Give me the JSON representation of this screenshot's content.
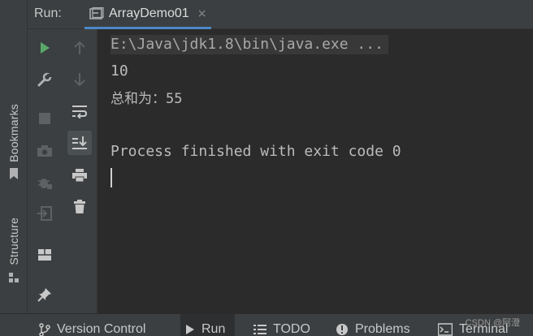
{
  "header": {
    "run_label": "Run:",
    "tab_label": "ArrayDemo01",
    "tab_close": "×"
  },
  "left_strip": {
    "bookmarks_label": "Bookmarks",
    "structure_label": "Structure"
  },
  "console": {
    "command": "E:\\Java\\jdk1.8\\bin\\java.exe ...",
    "lines": [
      "10",
      "总和为：55",
      "Process finished with exit code 0"
    ]
  },
  "bottom_bar": {
    "version_control": "Version Control",
    "run": "Run",
    "todo": "TODO",
    "problems": "Problems",
    "terminal": "Terminal",
    "watermark": "CSDN @阿澄"
  },
  "colors": {
    "accent": "#4a88c7",
    "run_green": "#59a869",
    "icon_grey": "#afb1b3",
    "icon_dim": "#5e6163"
  }
}
